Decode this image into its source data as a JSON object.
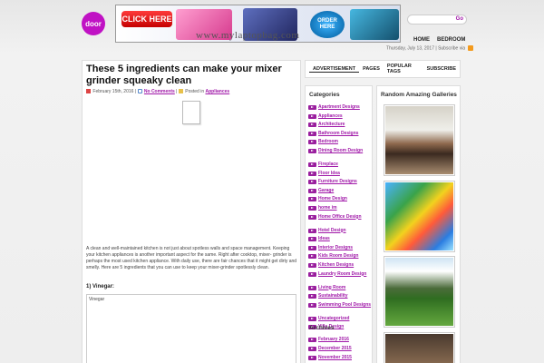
{
  "header": {
    "logo_text": "door",
    "banner": {
      "click_label": "CLICK HERE",
      "order_label": "ORDER HERE",
      "url_text": "www.mylaptopbag.com"
    },
    "search": {
      "placeholder": "",
      "go_label": "Go"
    },
    "nav": [
      "HOME",
      "BEDROOM"
    ],
    "dateline": "Thursday, July 13, 2017 | Subscribe via"
  },
  "post": {
    "title": "These 5 ingredients can make your mixer grinder squeaky clean",
    "date": "February 15th, 2016",
    "comments": "No Comments",
    "posted_in_label": "Posted in",
    "category": "Appliances",
    "body": "A clean and well-maintained kitchen is not just about spotless walls and space management. Keeping your kitchen appliances is another important aspect for the same. Right after cooktop, mixer- grinder is perhaps the most used kitchen appliance. With daily use, there are fair chances that it might get dirty and smelly. Here are 5 ingredients that you can use to keep your mixer-grinder spotlessly clean.",
    "subheading": "1) Vinegar:",
    "frame_caption": "Vinegar"
  },
  "tabs": [
    "ADVERTISEMENT",
    "PAGES",
    "POPULAR TAGS",
    "SUBSCRIBE"
  ],
  "sidebar": {
    "categories_title": "Categories",
    "categories": [
      "Apartment Designs",
      "Appliances",
      "Architecture",
      "Bathroom Designs",
      "Bedroom",
      "Dining Room Design",
      "Fireplace",
      "Floor Idea",
      "Furniture Designs",
      "Garage",
      "Home Design",
      "home im",
      "Home Office Design",
      "Hotel Design",
      "Ideas",
      "Interior Designs",
      "Kids Room Design",
      "Kitchen Designs",
      "Laundry Room Design",
      "Living Room",
      "Sustainability",
      "Swimming Pool Designs",
      "Uncategorized",
      "Villa Design"
    ],
    "archives_title": "Archives",
    "archives": [
      "February 2016",
      "December 2015",
      "November 2015"
    ],
    "gallery_title": "Random Amazing Galleries"
  },
  "colors": {
    "accent": "#a018a8",
    "logo": "#c012c4"
  }
}
